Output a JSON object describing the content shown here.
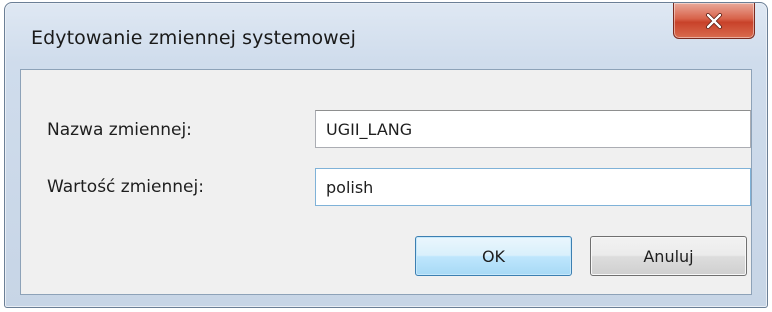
{
  "window": {
    "title": "Edytowanie zmiennej systemowej",
    "close_icon": "close-icon"
  },
  "form": {
    "name_label": "Nazwa zmiennej:",
    "name_value": "UGII_LANG",
    "value_label": "Wartość zmiennej:",
    "value_value": "polish"
  },
  "buttons": {
    "ok_label": "OK",
    "cancel_label": "Anuluj"
  },
  "colors": {
    "close_button": "#c8422a",
    "ok_button_border": "#3c7fb1",
    "titlebar": "#cfdcec"
  }
}
